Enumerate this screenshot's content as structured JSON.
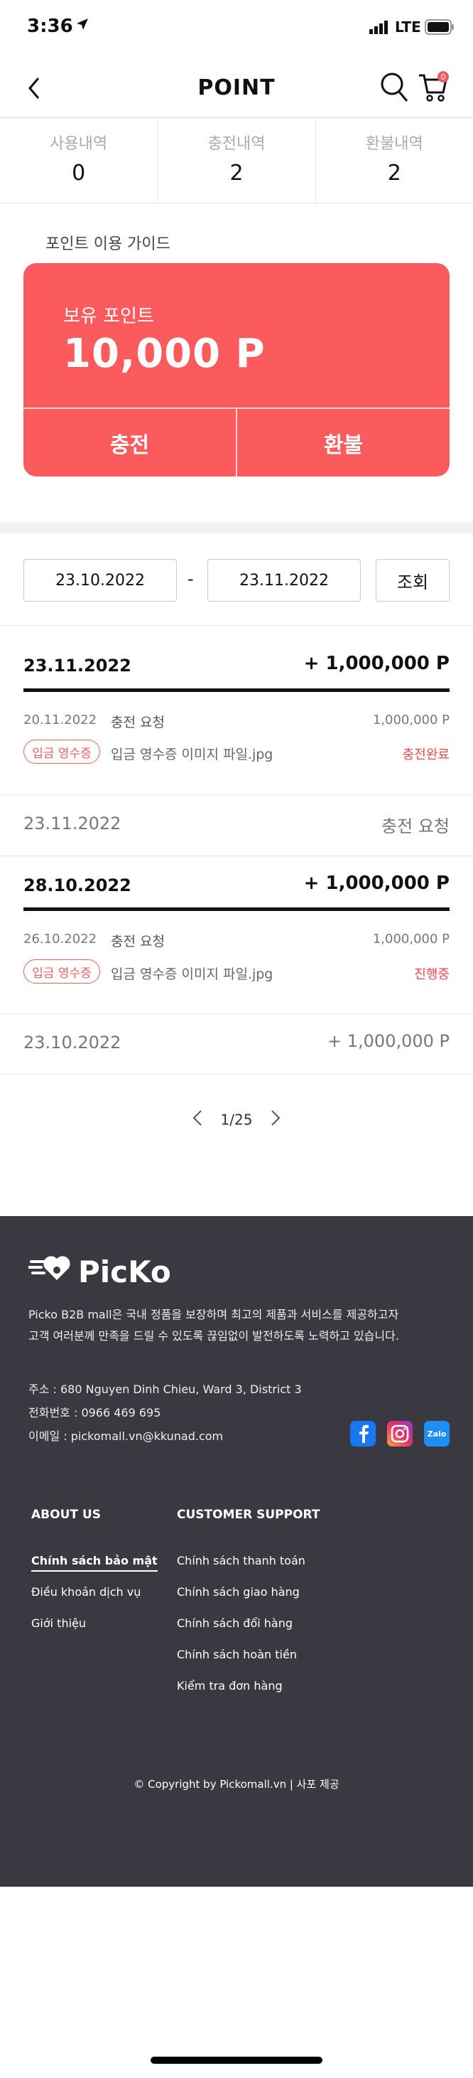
{
  "status_bar": {
    "time": "3:36",
    "network": "LTE"
  },
  "header": {
    "title": "POINT"
  },
  "cart_badge": "0",
  "summary_tabs": [
    {
      "label": "사용내역",
      "count": "0"
    },
    {
      "label": "충전내역",
      "count": "2"
    },
    {
      "label": "환불내역",
      "count": "2"
    }
  ],
  "guide_link": "포인트 이용 가이드",
  "point_card": {
    "label": "보유 포인트",
    "amount": "10,000 P",
    "charge_label": "충전",
    "refund_label": "환불",
    "color": "#fb5b5d"
  },
  "filter": {
    "start_date": "23.10.2022",
    "separator": "-",
    "end_date": "23.11.2022",
    "search_label": "조회"
  },
  "records": [
    {
      "date": "23.11.2022",
      "amount": "+ 1,000,000 P",
      "detail": {
        "date": "20.11.2022",
        "type": "충전 요청",
        "amount": "1,000,000 P",
        "badge": "입금 영수증",
        "file": "입금 영수증 이미지 파일.jpg",
        "status": "충전완료"
      }
    },
    {
      "date": "23.11.2022",
      "summary": "충전 요청"
    },
    {
      "date": "28.10.2022",
      "amount": "+ 1,000,000 P",
      "detail": {
        "date": "26.10.2022",
        "type": "충전 요청",
        "amount": "1,000,000 P",
        "badge": "입금 영수증",
        "file": "입금 영수증 이미지 파일.jpg",
        "status": "진행중"
      }
    },
    {
      "date": "23.10.2022",
      "summary": "+ 1,000,000 P"
    }
  ],
  "pagination": {
    "text": "1/25"
  },
  "footer": {
    "brand": "PicKo",
    "desc_line1": "Picko B2B mall은 국내 정품을 보장하며 최고의 제품과 서비스를 제공하고자",
    "desc_line2": "고객 여러분께 만족을 드릴 수 있도록 끊임없이 발전하도록 노력하고 있습니다.",
    "address": "주소 : 680 Nguyen Dinh Chieu, Ward 3, District 3",
    "phone": "전화번호 : 0966 469 695",
    "email": "이메일 : pickomall.vn@kkunad.com",
    "social": [
      "facebook-icon",
      "instagram-icon",
      "zalo-icon"
    ],
    "zalo_label": "Zalo",
    "about_title": "ABOUT US",
    "about_links": [
      "Chính sách bảo mật",
      "Điều khoản dịch vụ",
      "Giới thiệu"
    ],
    "support_title": "CUSTOMER SUPPORT",
    "support_links": [
      "Chính sách thanh toán",
      "Chính sách giao hàng",
      "Chính sách đổi hàng",
      "Chính sách hoàn tiền",
      "Kiểm tra đơn hàng"
    ],
    "copyright": "© Copyright by Pickomall.vn | 사포 제공"
  }
}
